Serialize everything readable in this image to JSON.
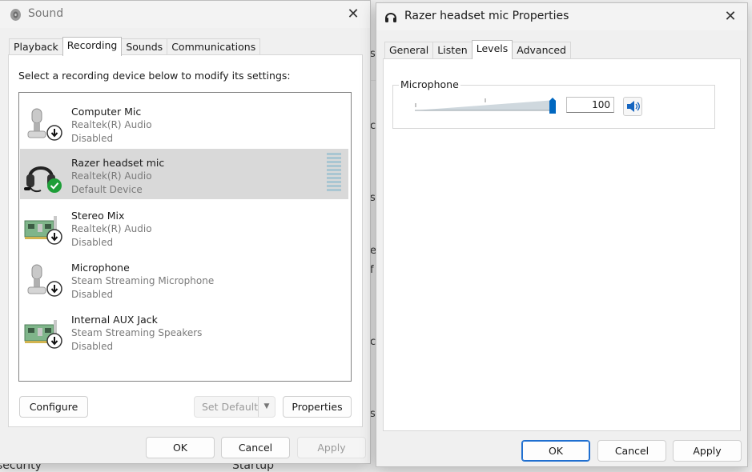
{
  "background": {
    "fragments": [
      "s",
      "c",
      "s",
      "f",
      "e",
      "c",
      "s,",
      "security",
      "Startup"
    ]
  },
  "sound_window": {
    "title": "Sound",
    "tabs": [
      "Playback",
      "Recording",
      "Sounds",
      "Communications"
    ],
    "active_tab": "Recording",
    "instruction": "Select a recording device below to modify its settings:",
    "devices": [
      {
        "name": "Computer Mic",
        "driver": "Realtek(R) Audio",
        "status": "Disabled",
        "icon": "microphone-icon",
        "badge": "disabled-arrow"
      },
      {
        "name": "Razer headset mic",
        "driver": "Realtek(R) Audio",
        "status": "Default Device",
        "icon": "headset-icon",
        "badge": "default-check",
        "selected": true
      },
      {
        "name": "Stereo Mix",
        "driver": "Realtek(R) Audio",
        "status": "Disabled",
        "icon": "sound-card-icon",
        "badge": "disabled-arrow"
      },
      {
        "name": "Microphone",
        "driver": "Steam Streaming Microphone",
        "status": "Disabled",
        "icon": "microphone-icon",
        "badge": "disabled-arrow"
      },
      {
        "name": "Internal AUX Jack",
        "driver": "Steam Streaming Speakers",
        "status": "Disabled",
        "icon": "sound-card-icon",
        "badge": "disabled-arrow"
      }
    ],
    "buttons": {
      "configure": "Configure",
      "set_default": "Set Default",
      "properties": "Properties",
      "ok": "OK",
      "cancel": "Cancel",
      "apply": "Apply"
    }
  },
  "props_window": {
    "title": "Razer headset mic Properties",
    "tabs": [
      "General",
      "Listen",
      "Levels",
      "Advanced"
    ],
    "active_tab": "Levels",
    "group_label": "Microphone",
    "level_value": "100",
    "level_fraction": 1.0,
    "buttons": {
      "ok": "OK",
      "cancel": "Cancel",
      "apply": "Apply"
    }
  },
  "colors": {
    "accent": "#0067c0",
    "check_green": "#1e9e38",
    "selected_row": "#d9d9d9",
    "meter": "#a9c6d2"
  }
}
